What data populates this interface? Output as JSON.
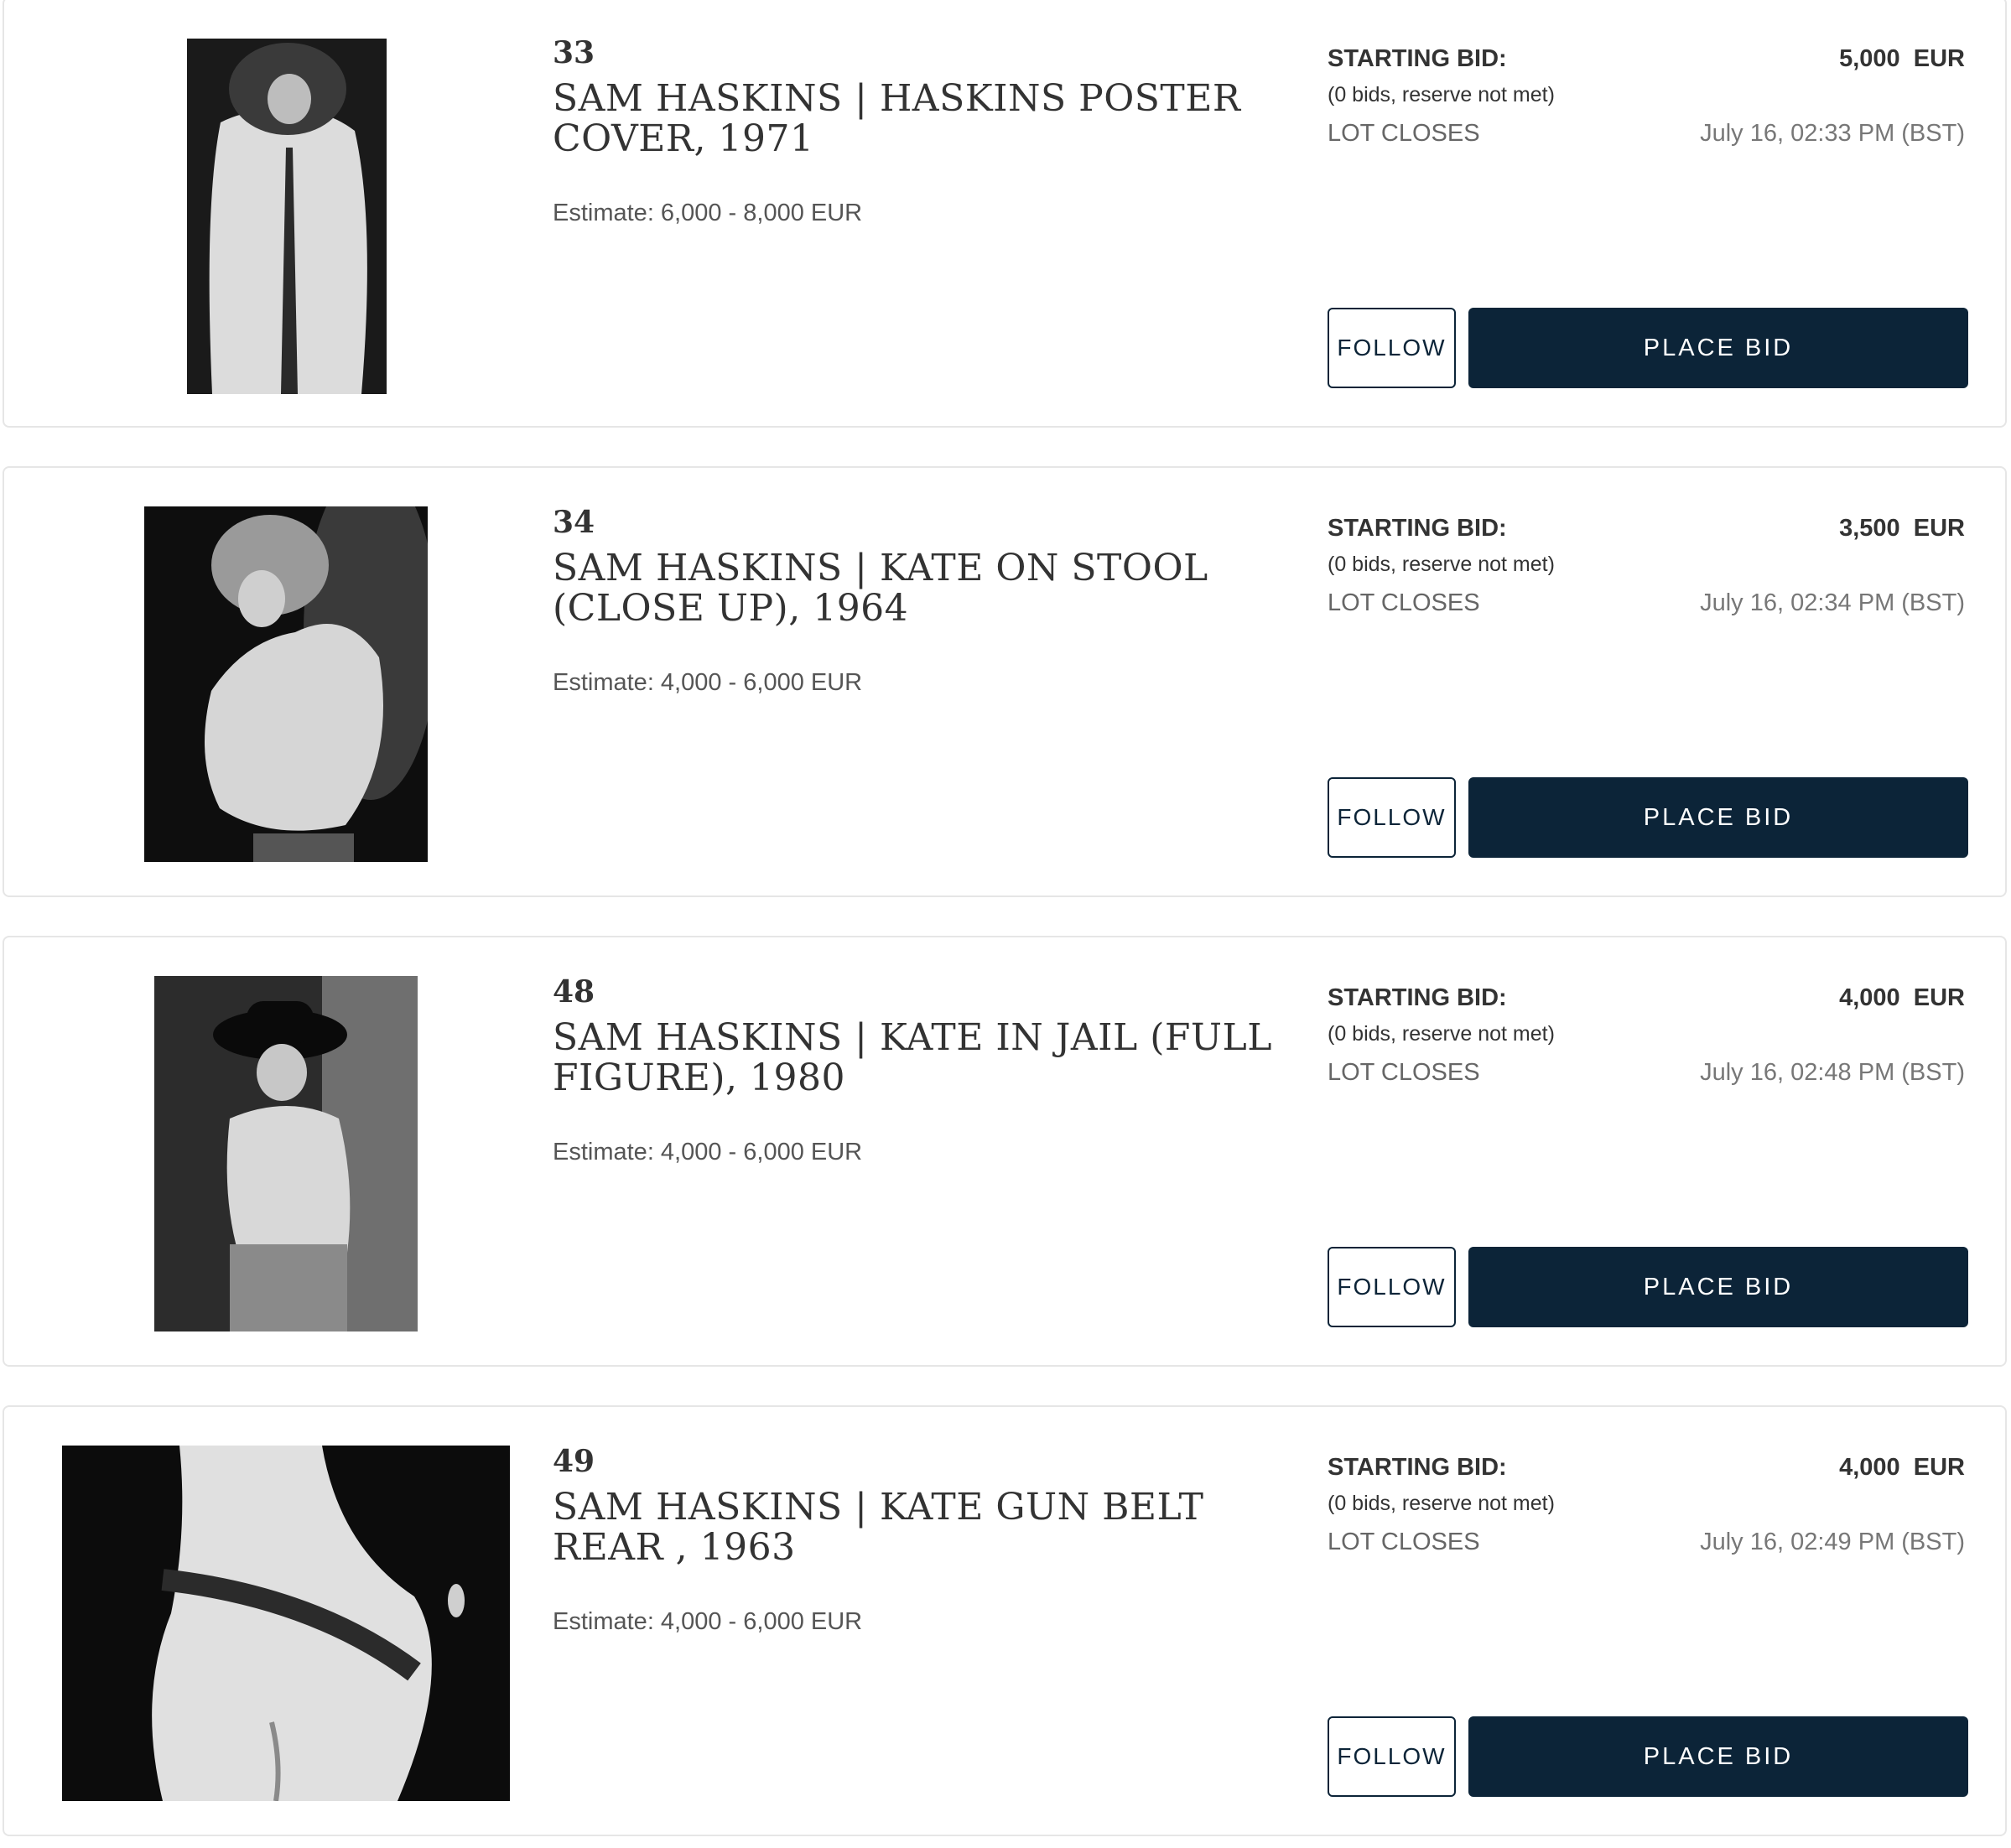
{
  "colors": {
    "button_navy": "#0c2438",
    "card_border": "#e6e6e6"
  },
  "labels": {
    "starting_bid": "STARTING BID:",
    "lot_closes": "LOT CLOSES",
    "follow": "FOLLOW",
    "place_bid": "PLACE BID"
  },
  "lots": [
    {
      "number": "33",
      "title": "SAM HASKINS | HASKINS POSTER COVER, 1971",
      "estimate": "Estimate: 6,000 - 8,000 EUR",
      "starting_bid": "5,000  EUR",
      "bids_status": "(0 bids, reserve not met)",
      "closes": "July 16, 02:33 PM (BST)",
      "image": "photo of nude woman seen from behind with curly hair"
    },
    {
      "number": "34",
      "title": "SAM HASKINS | KATE ON STOOL (CLOSE UP), 1964",
      "estimate": "Estimate: 4,000 - 6,000 EUR",
      "starting_bid": "3,500  EUR",
      "bids_status": "(0 bids, reserve not met)",
      "closes": "July 16, 02:34 PM (BST)",
      "image": "photo of woman crouching on stool"
    },
    {
      "number": "48",
      "title": "SAM HASKINS | KATE IN JAIL (FULL FIGURE), 1980",
      "estimate": "Estimate: 4,000 - 6,000 EUR",
      "starting_bid": "4,000  EUR",
      "bids_status": "(0 bids, reserve not met)",
      "closes": "July 16, 02:48 PM (BST)",
      "image": "photo of woman wearing hat"
    },
    {
      "number": "49",
      "title": "SAM HASKINS | KATE GUN BELT REAR , 1963",
      "estimate": "Estimate: 4,000 - 6,000 EUR",
      "starting_bid": "4,000  EUR",
      "bids_status": "(0 bids, reserve not met)",
      "closes": "July 16, 02:49 PM (BST)",
      "image": "photo of figure with gun belt"
    }
  ]
}
